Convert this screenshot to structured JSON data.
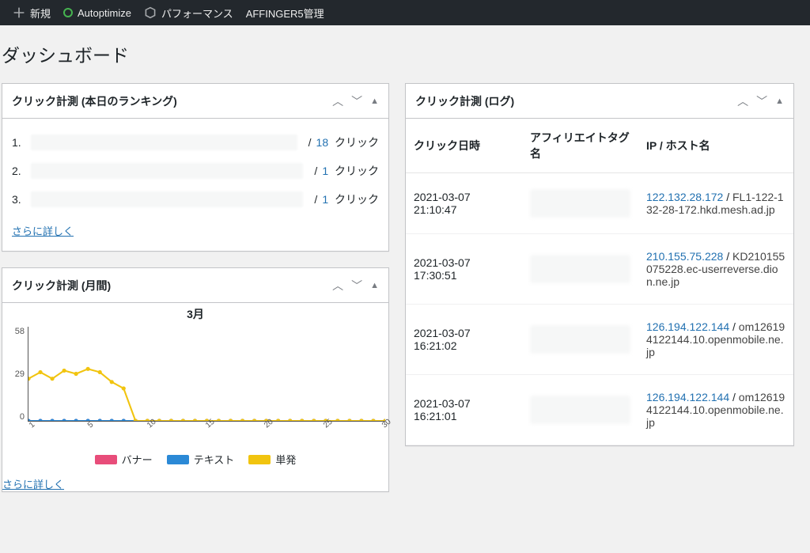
{
  "admin_bar": {
    "new": "新規",
    "autoptimize": "Autoptimize",
    "performance": "パフォーマンス",
    "affinger": "AFFINGER5管理"
  },
  "page_title": "ダッシュボード",
  "ranking_panel": {
    "title": "クリック計測 (本日のランキング)",
    "rows": [
      {
        "rank": "1.",
        "count": "18",
        "suffix": "クリック"
      },
      {
        "rank": "2.",
        "count": "1",
        "suffix": "クリック"
      },
      {
        "rank": "3.",
        "count": "1",
        "suffix": "クリック"
      }
    ],
    "more": "さらに詳しく"
  },
  "monthly_panel": {
    "title": "クリック計測 (月間)",
    "more": "さらに詳しく"
  },
  "log_panel": {
    "title": "クリック計測 (ログ)",
    "headers": {
      "datetime": "クリック日時",
      "tag": "アフィリエイトタグ名",
      "ip": "IP / ホスト名"
    },
    "rows": [
      {
        "dt": "2021-03-07 21:10:47",
        "ip": "122.132.28.172",
        "host": "FL1-122-132-28-172.hkd.mesh.ad.jp"
      },
      {
        "dt": "2021-03-07 17:30:51",
        "ip": "210.155.75.228",
        "host": "KD210155075228.ec-userreverse.dion.ne.jp"
      },
      {
        "dt": "2021-03-07 16:21:02",
        "ip": "126.194.122.144",
        "host": "om126194122144.10.openmobile.ne.jp"
      },
      {
        "dt": "2021-03-07 16:21:01",
        "ip": "126.194.122.144",
        "host": "om126194122144.10.openmobile.ne.jp"
      }
    ]
  },
  "chart_data": {
    "type": "line",
    "title": "3月",
    "xlabel": "",
    "ylabel": "",
    "ylim": [
      0,
      58
    ],
    "yticks": [
      0,
      29,
      58
    ],
    "x": [
      1,
      2,
      3,
      4,
      5,
      6,
      7,
      8,
      9,
      10,
      11,
      12,
      13,
      14,
      15,
      16,
      17,
      18,
      19,
      20,
      21,
      22,
      23,
      24,
      25,
      26,
      27,
      28,
      29,
      30,
      31
    ],
    "xticks": [
      1,
      5,
      10,
      15,
      20,
      25,
      30
    ],
    "series": [
      {
        "name": "バナー",
        "color": "#e84d7a",
        "values": [
          0,
          0,
          0,
          0,
          0,
          0,
          0,
          0,
          0,
          0,
          0,
          0,
          0,
          0,
          0,
          0,
          0,
          0,
          0,
          0,
          0,
          0,
          0,
          0,
          0,
          0,
          0,
          0,
          0,
          0,
          0
        ]
      },
      {
        "name": "テキスト",
        "color": "#2b89d6",
        "values": [
          0,
          0,
          0,
          0,
          0,
          0,
          0,
          0,
          0,
          0,
          0,
          0,
          0,
          0,
          0,
          0,
          0,
          0,
          0,
          0,
          0,
          0,
          0,
          0,
          0,
          0,
          0,
          0,
          0,
          0,
          0
        ]
      },
      {
        "name": "単発",
        "color": "#f1c40f",
        "values": [
          26,
          30,
          26,
          31,
          29,
          32,
          30,
          24,
          20,
          0,
          0,
          0,
          0,
          0,
          0,
          0,
          0,
          0,
          0,
          0,
          0,
          0,
          0,
          0,
          0,
          0,
          0,
          0,
          0,
          0,
          0
        ]
      }
    ],
    "legend": [
      "バナー",
      "テキスト",
      "単発"
    ]
  }
}
